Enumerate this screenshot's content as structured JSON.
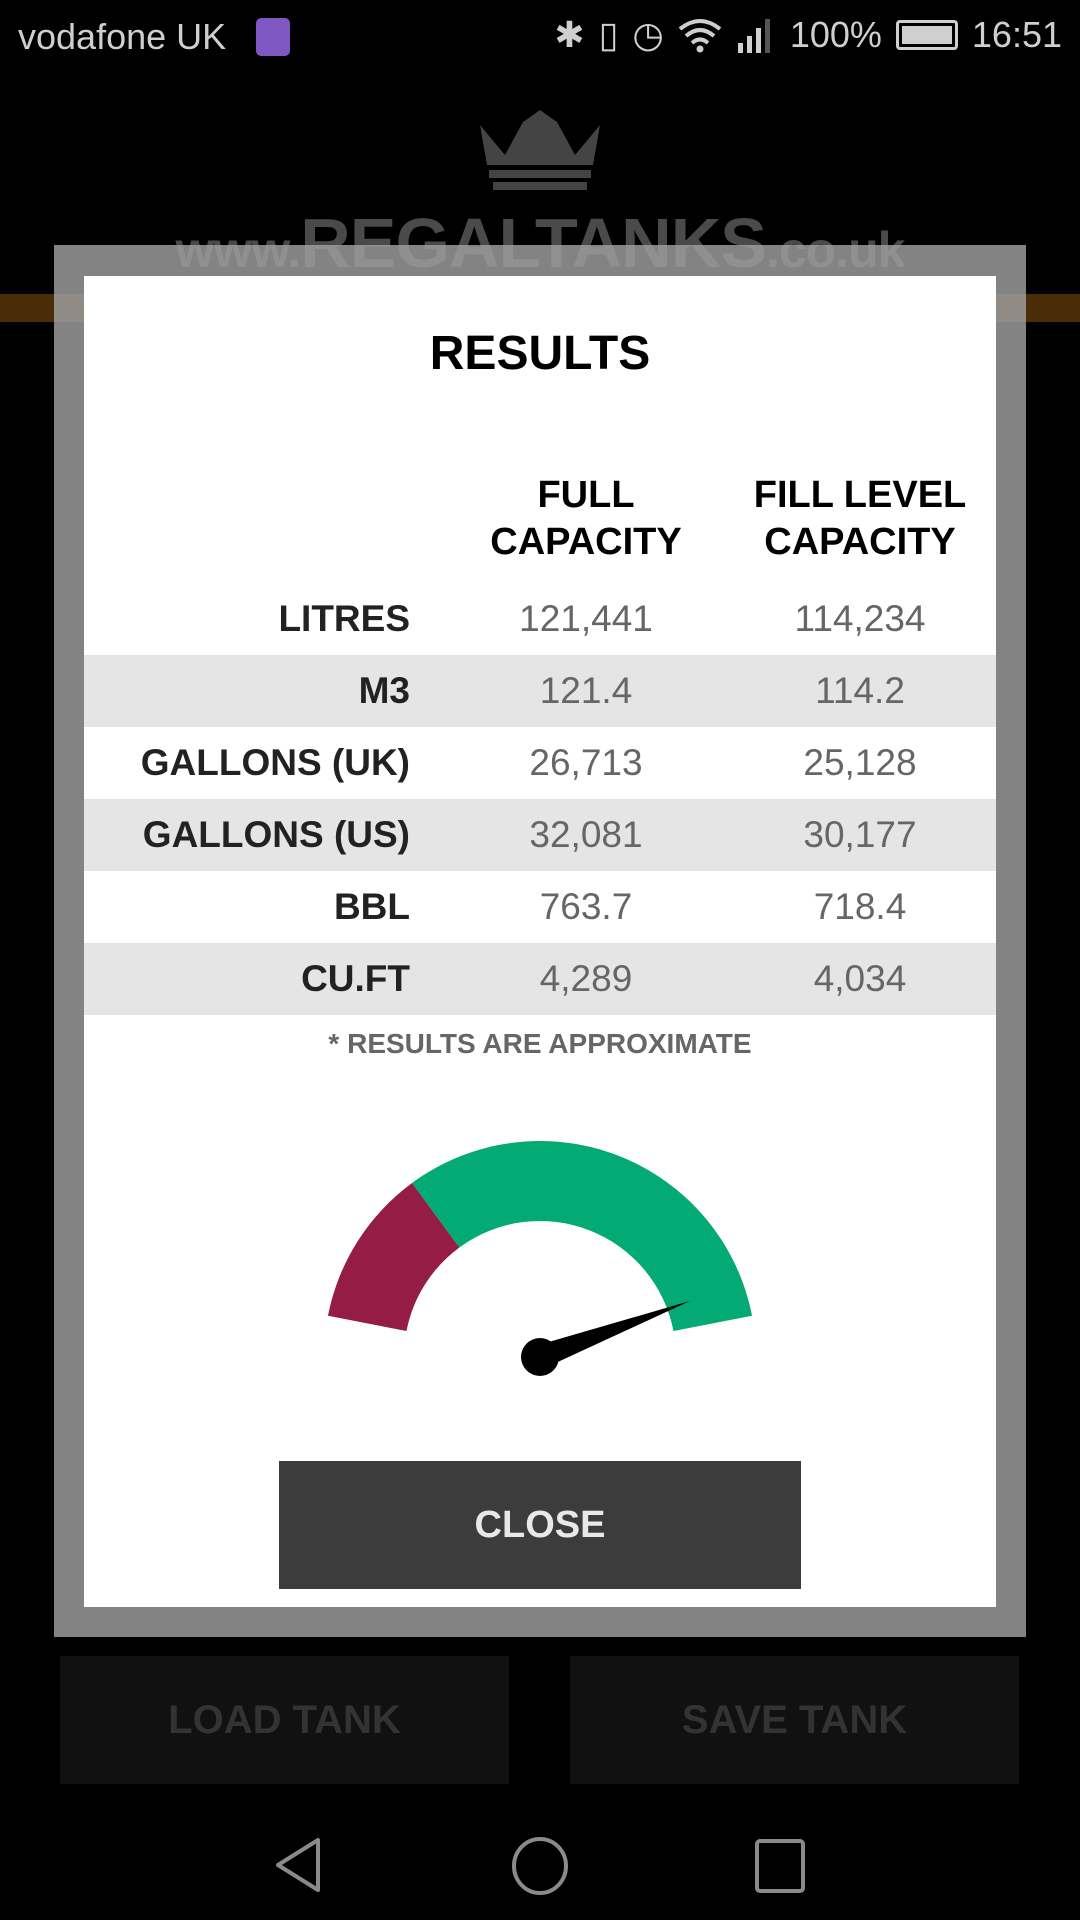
{
  "status_bar": {
    "carrier": "vodafone UK",
    "battery": "100%",
    "time": "16:51",
    "icons": [
      "image-notification-icon",
      "bluetooth-icon",
      "vibrate-icon",
      "alarm-icon",
      "wifi-icon",
      "signal-icon",
      "battery-icon"
    ]
  },
  "background": {
    "logo_text_prefix": "www.",
    "logo_text_main": "REGALTANKS",
    "logo_text_suffix": ".co.uk",
    "load_button": "LOAD TANK",
    "save_button": "SAVE TANK"
  },
  "dialog": {
    "title": "RESULTS",
    "columns": {
      "full_l1": "FULL",
      "full_l2": "CAPACITY",
      "fill_l1": "FILL LEVEL",
      "fill_l2": "CAPACITY"
    },
    "rows": [
      {
        "label": "LITRES",
        "full": "121,441",
        "fill": "114,234"
      },
      {
        "label": "M3",
        "full": "121.4",
        "fill": "114.2"
      },
      {
        "label": "GALLONS (UK)",
        "full": "26,713",
        "fill": "25,128"
      },
      {
        "label": "GALLONS (US)",
        "full": "32,081",
        "fill": "30,177"
      },
      {
        "label": "BBL",
        "full": "763.7",
        "fill": "718.4"
      },
      {
        "label": "CU.FT",
        "full": "4,289",
        "fill": "4,034"
      }
    ],
    "note": "* RESULTS ARE APPROXIMATE",
    "gauge": {
      "value_fraction": 0.94,
      "red_zone_fraction": 0.27,
      "colors": {
        "red": "#951c45",
        "green": "#03aa74",
        "needle": "#000000"
      }
    },
    "close_button": "CLOSE"
  },
  "nav": {
    "icons": [
      "back-icon",
      "home-icon",
      "recents-icon"
    ]
  }
}
